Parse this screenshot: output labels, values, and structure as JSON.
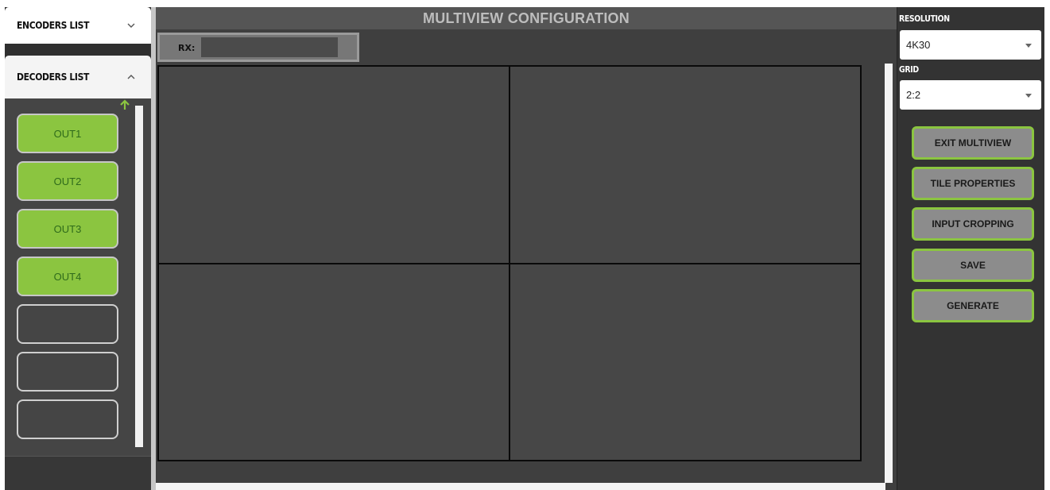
{
  "left": {
    "encoders_label": "ENCODERS LIST",
    "decoders_label": "DECODERS LIST",
    "outputs": [
      "OUT1",
      "OUT2",
      "OUT3",
      "OUT4",
      "",
      "",
      ""
    ]
  },
  "center": {
    "title": "MULTIVIEW CONFIGURATION",
    "rx_label": "RX:",
    "rx_value": ""
  },
  "right": {
    "resolution_label": "RESOLUTION",
    "resolution_value": "4K30",
    "grid_label": "GRID",
    "grid_value": "2:2",
    "buttons": {
      "exit_multiview": "EXIT MULTIVIEW",
      "tile_properties": "TILE PROPERTIES",
      "input_cropping": "INPUT CROPPING",
      "save": "SAVE",
      "generate": "GENERATE"
    }
  },
  "colors": {
    "accent_green": "#8bc540",
    "panel_dark": "#333333",
    "canvas": "#3f3f3f"
  },
  "icons": {
    "encoders_toggle": "chevron-down-icon",
    "decoders_toggle": "chevron-up-icon",
    "scroll_up": "arrow-up-icon",
    "select_caret": "caret-down-icon"
  }
}
